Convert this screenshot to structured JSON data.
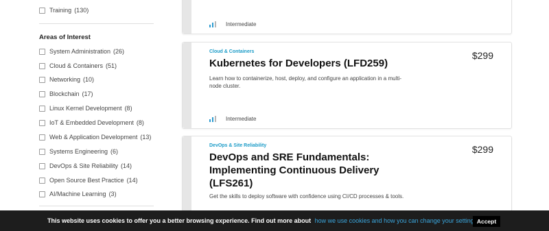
{
  "sidebar": {
    "top_item": {
      "label": "Training",
      "count": "(130)"
    },
    "section_title": "Areas of Interest",
    "items": [
      {
        "label": "System Administration",
        "count": "(26)"
      },
      {
        "label": "Cloud & Containers",
        "count": "(51)"
      },
      {
        "label": "Networking",
        "count": "(10)"
      },
      {
        "label": "Blockchain",
        "count": "(17)"
      },
      {
        "label": "Linux Kernel Development",
        "count": "(8)"
      },
      {
        "label": "IoT & Embedded Development",
        "count": "(8)"
      },
      {
        "label": "Web & Application Development",
        "count": "(13)"
      },
      {
        "label": "Systems Engineering",
        "count": "(6)"
      },
      {
        "label": "DevOps & Site Reliability",
        "count": "(14)"
      },
      {
        "label": "Open Source Best Practice",
        "count": "(14)"
      },
      {
        "label": "AI/Machine Learning",
        "count": "(3)"
      }
    ]
  },
  "cards": [
    {
      "level": "Intermediate"
    },
    {
      "category": "Cloud & Containers",
      "title": "Kubernetes for Developers (LFD259)",
      "description": "Learn how to containerize, host, deploy, and configure an application in a multi-node cluster.",
      "price": "$299",
      "level": "Intermediate"
    },
    {
      "category": "DevOps & Site Reliability",
      "title": "DevOps and SRE Fundamentals: Implementing Continuous Delivery (LFS261)",
      "description": "Get the skills to deploy software with confidence using CI/CD processes & tools.",
      "price": "$299"
    }
  ],
  "cookie_bar": {
    "text": "This website uses cookies to offer you a better browsing experience. Find out more about",
    "link": "how we use cookies and how you can change your settings.",
    "accept_label": "Accept"
  },
  "colors": {
    "accent": "#1a9bc7",
    "level_bar_active": "#2a9ad0",
    "level_bar_inactive": "#b8b8b8",
    "cookie_bar_bg": "#1d1d1d"
  }
}
